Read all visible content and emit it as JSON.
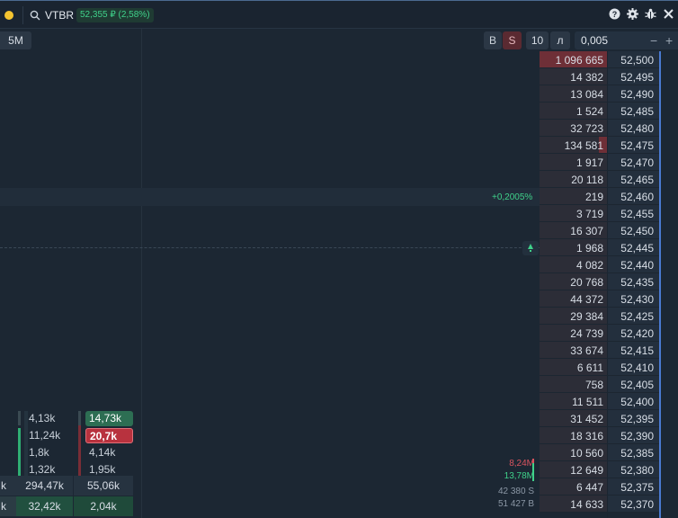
{
  "header": {
    "ticker": "VTBR",
    "price_badge": "52,355 ₽ (2,58%)",
    "icons": [
      "help-icon",
      "gear-icon",
      "bug-icon",
      "close-icon"
    ]
  },
  "toolbar": {
    "timeframe": "5M",
    "buy_label": "B",
    "sell_label": "S",
    "lot_label": "10",
    "lot_unit": "л",
    "step_value": "0,005",
    "minus": "−",
    "plus": "+"
  },
  "chart": {
    "change_label": "+0,2005%"
  },
  "orderbook": [
    {
      "volume": "1 096 665",
      "price": "52,500",
      "side": "ask",
      "fill": 1.0
    },
    {
      "volume": "14 382",
      "price": "52,495",
      "side": "ask",
      "fill": 0.0
    },
    {
      "volume": "13 084",
      "price": "52,490",
      "side": "ask",
      "fill": 0.0
    },
    {
      "volume": "1 524",
      "price": "52,485",
      "side": "ask",
      "fill": 0.0
    },
    {
      "volume": "32 723",
      "price": "52,480",
      "side": "ask",
      "fill": 0.0
    },
    {
      "volume": "134 581",
      "price": "52,475",
      "side": "ask",
      "fill": 0.12
    },
    {
      "volume": "1 917",
      "price": "52,470",
      "side": "ask",
      "fill": 0.0
    },
    {
      "volume": "20 118",
      "price": "52,465",
      "side": "ask",
      "fill": 0.0
    },
    {
      "volume": "219",
      "price": "52,460",
      "side": "ask",
      "fill": 0.0
    },
    {
      "volume": "3 719",
      "price": "52,455",
      "side": "bid",
      "fill": 0.0
    },
    {
      "volume": "16 307",
      "price": "52,450",
      "side": "bid",
      "fill": 0.0
    },
    {
      "volume": "1 968",
      "price": "52,445",
      "side": "bid",
      "fill": 0.0
    },
    {
      "volume": "4 082",
      "price": "52,440",
      "side": "bid",
      "fill": 0.0
    },
    {
      "volume": "20 768",
      "price": "52,435",
      "side": "bid",
      "fill": 0.0
    },
    {
      "volume": "44 372",
      "price": "52,430",
      "side": "bid",
      "fill": 0.0
    },
    {
      "volume": "29 384",
      "price": "52,425",
      "side": "bid",
      "fill": 0.0
    },
    {
      "volume": "24 739",
      "price": "52,420",
      "side": "bid",
      "fill": 0.0
    },
    {
      "volume": "33 674",
      "price": "52,415",
      "side": "bid",
      "fill": 0.0
    },
    {
      "volume": "6 611",
      "price": "52,410",
      "side": "bid",
      "fill": 0.0
    },
    {
      "volume": "758",
      "price": "52,405",
      "side": "bid",
      "fill": 0.0
    },
    {
      "volume": "11 511",
      "price": "52,400",
      "side": "bid",
      "fill": 0.0
    },
    {
      "volume": "31 452",
      "price": "52,395",
      "side": "bid",
      "fill": 0.0
    },
    {
      "volume": "18 316",
      "price": "52,390",
      "side": "bid",
      "fill": 0.0
    },
    {
      "volume": "10 560",
      "price": "52,385",
      "side": "bid",
      "fill": 0.0
    },
    {
      "volume": "12 649",
      "price": "52,380",
      "side": "bid",
      "fill": 0.0
    },
    {
      "volume": "6 447",
      "price": "52,375",
      "side": "bid",
      "fill": 0.0
    },
    {
      "volume": "14 633",
      "price": "52,370",
      "side": "bid",
      "fill": 0.0
    }
  ],
  "clusters": {
    "col1": [
      "4,13k",
      "11,24k",
      "1,8k",
      "1,32k"
    ],
    "col2": [
      "14,73k",
      "20,7k",
      "4,14k",
      "1,95k"
    ],
    "totals_row1": [
      "k",
      "294,47k",
      "55,06k"
    ],
    "totals_row2": [
      "k",
      "32,42k",
      "2,04k"
    ]
  },
  "stats": {
    "sell_volume": "8,24M",
    "buy_volume": "13,78M",
    "sell_count": "42 380 S",
    "buy_count": "51 427 B"
  },
  "colors": {
    "green": "#3fd18a",
    "red": "#d9545f",
    "accent_blue": "#4a7ad1"
  }
}
